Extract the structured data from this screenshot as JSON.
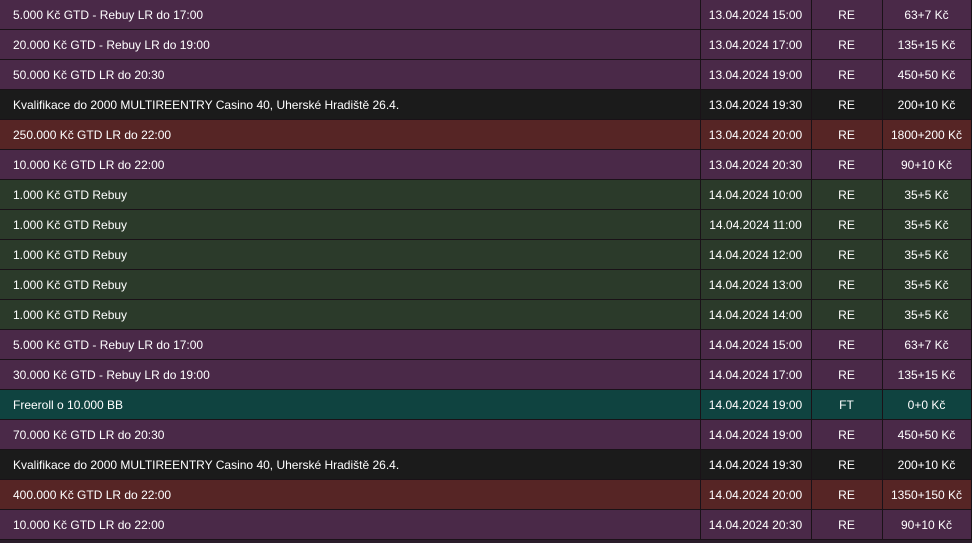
{
  "rows": [
    {
      "name": "5.000 Kč GTD - Rebuy LR do 17:00",
      "datetime": "13.04.2024 15:00",
      "type": "RE",
      "buyin": "63+7 Kč",
      "color": "purple"
    },
    {
      "name": "20.000 Kč GTD - Rebuy LR do 19:00",
      "datetime": "13.04.2024 17:00",
      "type": "RE",
      "buyin": "135+15 Kč",
      "color": "purple"
    },
    {
      "name": "50.000 Kč GTD LR do 20:30",
      "datetime": "13.04.2024 19:00",
      "type": "RE",
      "buyin": "450+50 Kč",
      "color": "purple"
    },
    {
      "name": "Kvalifikace do 2000 MULTIREENTRY Casino 40, Uherské Hradiště 26.4.",
      "datetime": "13.04.2024 19:30",
      "type": "RE",
      "buyin": "200+10 Kč",
      "color": "black"
    },
    {
      "name": "250.000 Kč GTD LR do 22:00",
      "datetime": "13.04.2024 20:00",
      "type": "RE",
      "buyin": "1800+200 Kč",
      "color": "red"
    },
    {
      "name": "10.000 Kč GTD LR do 22:00",
      "datetime": "13.04.2024 20:30",
      "type": "RE",
      "buyin": "90+10 Kč",
      "color": "purple"
    },
    {
      "name": "1.000 Kč GTD Rebuy",
      "datetime": "14.04.2024 10:00",
      "type": "RE",
      "buyin": "35+5 Kč",
      "color": "green"
    },
    {
      "name": "1.000 Kč GTD Rebuy",
      "datetime": "14.04.2024 11:00",
      "type": "RE",
      "buyin": "35+5 Kč",
      "color": "green"
    },
    {
      "name": "1.000 Kč GTD Rebuy",
      "datetime": "14.04.2024 12:00",
      "type": "RE",
      "buyin": "35+5 Kč",
      "color": "green"
    },
    {
      "name": "1.000 Kč GTD Rebuy",
      "datetime": "14.04.2024 13:00",
      "type": "RE",
      "buyin": "35+5 Kč",
      "color": "green"
    },
    {
      "name": "1.000 Kč GTD Rebuy",
      "datetime": "14.04.2024 14:00",
      "type": "RE",
      "buyin": "35+5 Kč",
      "color": "green"
    },
    {
      "name": "5.000 Kč GTD - Rebuy LR do 17:00",
      "datetime": "14.04.2024 15:00",
      "type": "RE",
      "buyin": "63+7 Kč",
      "color": "purple"
    },
    {
      "name": "30.000 Kč GTD - Rebuy LR do 19:00",
      "datetime": "14.04.2024 17:00",
      "type": "RE",
      "buyin": "135+15 Kč",
      "color": "purple"
    },
    {
      "name": "Freeroll o 10.000 BB",
      "datetime": "14.04.2024 19:00",
      "type": "FT",
      "buyin": "0+0 Kč",
      "color": "teal"
    },
    {
      "name": "70.000 Kč GTD LR do 20:30",
      "datetime": "14.04.2024 19:00",
      "type": "RE",
      "buyin": "450+50 Kč",
      "color": "purple"
    },
    {
      "name": "Kvalifikace do 2000 MULTIREENTRY Casino 40, Uherské Hradiště 26.4.",
      "datetime": "14.04.2024 19:30",
      "type": "RE",
      "buyin": "200+10 Kč",
      "color": "black"
    },
    {
      "name": "400.000 Kč GTD LR do 22:00",
      "datetime": "14.04.2024 20:00",
      "type": "RE",
      "buyin": "1350+150 Kč",
      "color": "red"
    },
    {
      "name": "10.000 Kč GTD LR do 22:00",
      "datetime": "14.04.2024 20:30",
      "type": "RE",
      "buyin": "90+10 Kč",
      "color": "purple"
    }
  ]
}
